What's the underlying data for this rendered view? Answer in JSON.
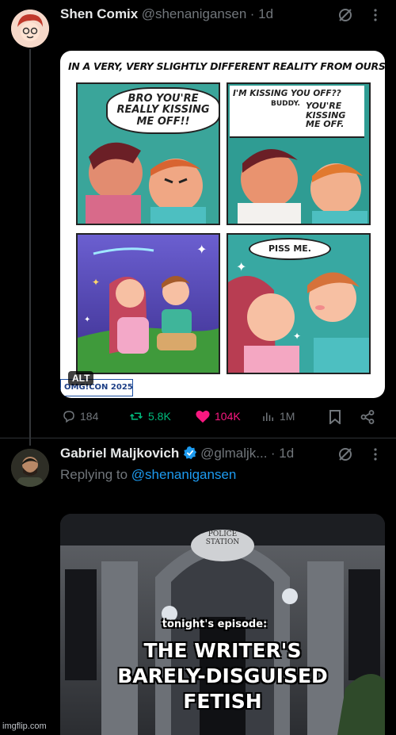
{
  "post": {
    "author_name": "Shen Comix",
    "author_handle": "@shenanigansen",
    "time": "· 1d",
    "comic": {
      "title": "IN A VERY, VERY SLIGHTLY DIFFERENT REALITY FROM OURS",
      "panel1_text": "BRO YOU'RE REALLY KISSING ME OFF!!",
      "panel2_text_a": "I'M KISSING YOU OFF??",
      "panel2_text_b": "BUDDY.",
      "panel2_text_c": "YOU'RE KISSING ME OFF.",
      "panel4_text": "PISS ME.",
      "con_label": "OMG!CON 2025"
    },
    "alt_badge": "ALT",
    "replies": "184",
    "reposts": "5.8K",
    "likes": "104K",
    "views": "1M"
  },
  "reply": {
    "author_name": "Gabriel Maljkovich",
    "author_handle": "@glmaljk...",
    "time": "· 1d",
    "replying_prefix": "Replying to",
    "replying_handle": "@shenanigansen",
    "meme": {
      "sign_line1": "POLICE",
      "sign_line2": "STATION",
      "caption_small": "tonight's episode:",
      "caption_big_1": "THE WRITER'S",
      "caption_big_2": "BARELY-DISGUISED",
      "caption_big_3": "FETISH"
    }
  },
  "watermark": "imgflip.com",
  "colors": {
    "background": "#000000",
    "muted": "#71767b",
    "link": "#1d9bf0",
    "like": "#f91880",
    "repost": "#00ba7c",
    "verified": "#1d9bf0"
  }
}
